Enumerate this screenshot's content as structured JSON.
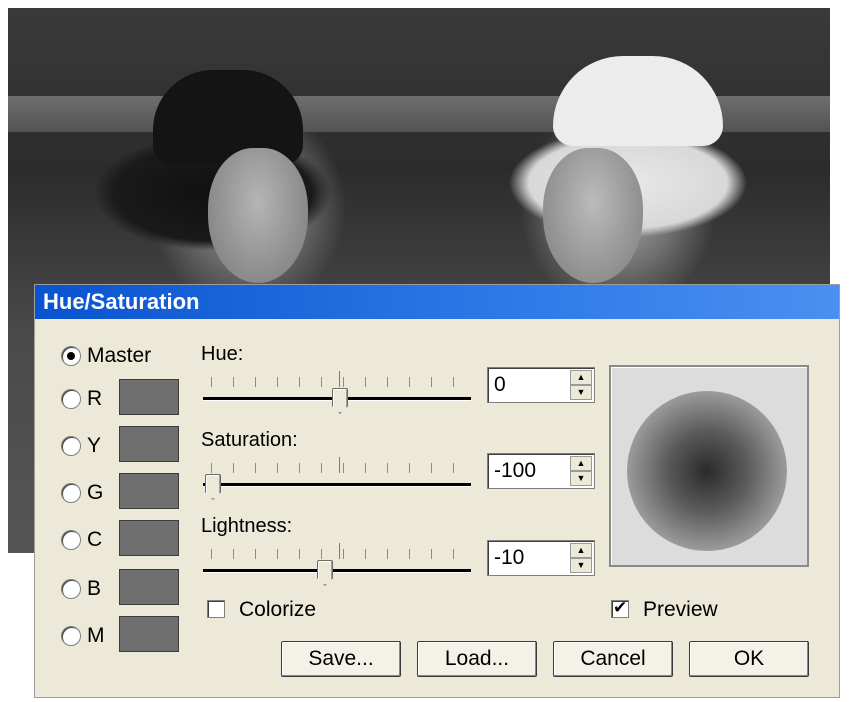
{
  "dialog": {
    "title": "Hue/Saturation",
    "channels": [
      {
        "key": "master",
        "label": "Master",
        "checked": true
      },
      {
        "key": "r",
        "label": "R",
        "checked": false
      },
      {
        "key": "y",
        "label": "Y",
        "checked": false
      },
      {
        "key": "g",
        "label": "G",
        "checked": false
      },
      {
        "key": "c",
        "label": "C",
        "checked": false
      },
      {
        "key": "b",
        "label": "B",
        "checked": false
      },
      {
        "key": "m",
        "label": "M",
        "checked": false
      }
    ],
    "hue": {
      "label": "Hue:",
      "value": "0"
    },
    "saturation": {
      "label": "Saturation:",
      "value": "-100"
    },
    "lightness": {
      "label": "Lightness:",
      "value": "-10"
    },
    "colorize": {
      "label": "Colorize",
      "checked": false
    },
    "preview": {
      "label": "Preview",
      "checked": true
    },
    "buttons": {
      "save": "Save...",
      "load": "Load...",
      "cancel": "Cancel",
      "ok": "OK"
    }
  }
}
